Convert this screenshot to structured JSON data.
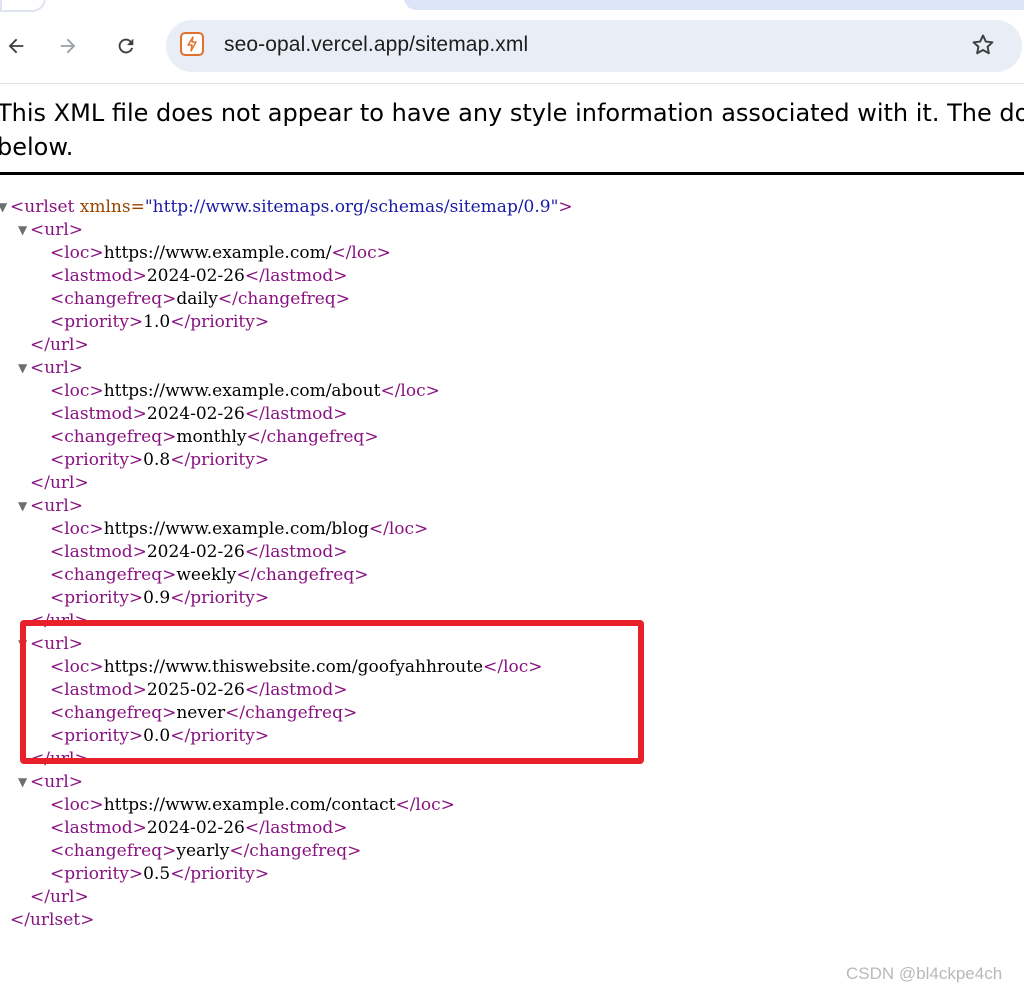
{
  "browser": {
    "url": "seo-opal.vercel.app/sitemap.xml",
    "icons": {
      "back": "arrow-left-icon",
      "forward": "arrow-right-icon",
      "reload": "reload-icon",
      "site": "site-info-icon",
      "bookmark": "star-icon"
    }
  },
  "notice": {
    "line1": "This XML file does not appear to have any style information associated with it. The doc",
    "line2": "below."
  },
  "xml": {
    "root_open_tag": "<urlset",
    "root_attr_name": "xmlns=",
    "root_attr_value": "\"http://www.sitemaps.org/schemas/sitemap/0.9\"",
    "root_open_end": ">",
    "root_close": "</urlset>",
    "url_open": "<url>",
    "url_close": "</url>",
    "entries": [
      {
        "loc": "https://www.example.com/",
        "lastmod": "2024-02-26",
        "changefreq": "daily",
        "priority": "1.0"
      },
      {
        "loc": "https://www.example.com/about",
        "lastmod": "2024-02-26",
        "changefreq": "monthly",
        "priority": "0.8"
      },
      {
        "loc": "https://www.example.com/blog",
        "lastmod": "2024-02-26",
        "changefreq": "weekly",
        "priority": "0.9"
      },
      {
        "loc": "https://www.thiswebsite.com/goofyahhroute",
        "lastmod": "2025-02-26",
        "changefreq": "never",
        "priority": "0.0"
      },
      {
        "loc": "https://www.example.com/contact",
        "lastmod": "2024-02-26",
        "changefreq": "yearly",
        "priority": "0.5"
      }
    ],
    "tags": {
      "loc_open": "<loc>",
      "loc_close": "</loc>",
      "lastmod_open": "<lastmod>",
      "lastmod_close": "</lastmod>",
      "changefreq_open": "<changefreq>",
      "changefreq_close": "</changefreq>",
      "priority_open": "<priority>",
      "priority_close": "</priority>"
    }
  },
  "annotation": {
    "color": "#e8202a",
    "highlighted_entry": 3
  },
  "watermark": "CSDN @bl4ckpe4ch",
  "colors": {
    "tag": "#881280",
    "attribute": "#994500",
    "attribute_value": "#1a1aa6",
    "omnibox": "#e8edf6"
  }
}
